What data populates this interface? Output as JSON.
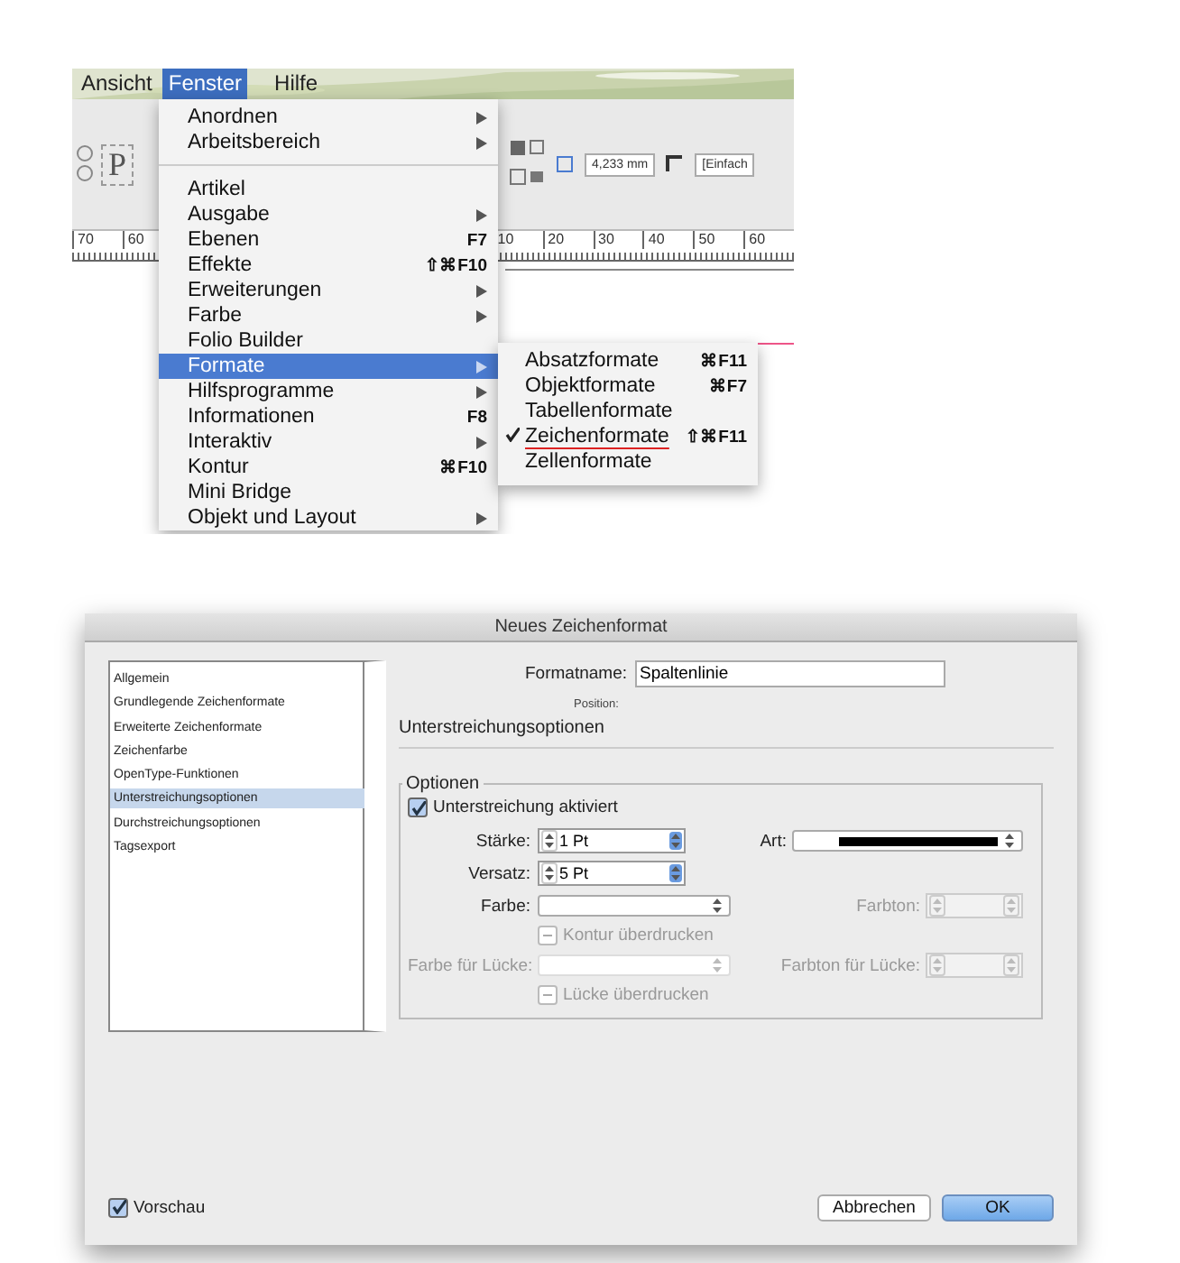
{
  "document_window": {
    "menu_bar": [
      {
        "label": "Ansicht",
        "selected": false
      },
      {
        "label": "Fenster",
        "selected": true
      },
      {
        "label": "Hilfe",
        "selected": false
      }
    ],
    "toolbar": {
      "style_letter": "P",
      "offset_field": "4,233 mm",
      "style_field": "[Einfach"
    },
    "ruler": {
      "left_labels": [
        "70",
        "60"
      ],
      "right_labels": [
        "10",
        "20",
        "30",
        "40",
        "50",
        "60"
      ]
    },
    "menu": [
      {
        "kind": "item",
        "label": "Anordnen",
        "has_submenu": true,
        "selected": false
      },
      {
        "kind": "item",
        "label": "Arbeitsbereich",
        "has_submenu": true,
        "selected": false
      },
      {
        "kind": "separator"
      },
      {
        "kind": "item",
        "label": "Artikel",
        "has_submenu": false,
        "selected": false
      },
      {
        "kind": "item",
        "label": "Ausgabe",
        "has_submenu": true,
        "selected": false
      },
      {
        "kind": "item",
        "label": "Ebenen",
        "shortcut": "F7",
        "has_submenu": false,
        "selected": false
      },
      {
        "kind": "item",
        "label": "Effekte",
        "shortcut": "⇧⌘F10",
        "has_submenu": false,
        "selected": false
      },
      {
        "kind": "item",
        "label": "Erweiterungen",
        "has_submenu": true,
        "selected": false
      },
      {
        "kind": "item",
        "label": "Farbe",
        "has_submenu": true,
        "selected": false
      },
      {
        "kind": "item",
        "label": "Folio Builder",
        "has_submenu": false,
        "selected": false
      },
      {
        "kind": "item",
        "label": "Formate",
        "has_submenu": true,
        "selected": true
      },
      {
        "kind": "item",
        "label": "Hilfsprogramme",
        "has_submenu": true,
        "selected": false
      },
      {
        "kind": "item",
        "label": "Informationen",
        "shortcut": "F8",
        "has_submenu": false,
        "selected": false
      },
      {
        "kind": "item",
        "label": "Interaktiv",
        "has_submenu": true,
        "selected": false
      },
      {
        "kind": "item",
        "label": "Kontur",
        "shortcut": "⌘F10",
        "has_submenu": false,
        "selected": false
      },
      {
        "kind": "item",
        "label": "Mini Bridge",
        "has_submenu": false,
        "selected": false
      },
      {
        "kind": "item",
        "label": "Objekt und Layout",
        "has_submenu": true,
        "selected": false
      }
    ],
    "submenu": [
      {
        "label": "Absatzformate",
        "shortcut": "⌘F11",
        "checked": false
      },
      {
        "label": "Objektformate",
        "shortcut": "⌘F7",
        "checked": false
      },
      {
        "label": "Tabellenformate",
        "checked": false
      },
      {
        "label": "Zeichenformate",
        "shortcut": "⇧⌘F11",
        "checked": true
      },
      {
        "label": "Zellenformate",
        "checked": false
      }
    ]
  },
  "dialog": {
    "title": "Neues Zeichenformat",
    "categories": [
      {
        "label": "Allgemein",
        "selected": false
      },
      {
        "label": "Grundlegende Zeichenformate",
        "selected": false
      },
      {
        "label": "Erweiterte Zeichenformate",
        "selected": false
      },
      {
        "label": "Zeichenfarbe",
        "selected": false
      },
      {
        "label": "OpenType-Funktionen",
        "selected": false
      },
      {
        "label": "Unterstreichungsoptionen",
        "selected": true
      },
      {
        "label": "Durchstreichungsoptionen",
        "selected": false
      },
      {
        "label": "Tagsexport",
        "selected": false
      }
    ],
    "format_name": {
      "label": "Formatname:",
      "value": "Spaltenlinie"
    },
    "position_label": "Position:",
    "section_title": "Unterstreichungsoptionen",
    "group": {
      "title": "Optionen",
      "enable": {
        "label": "Unterstreichung aktiviert",
        "checked": true
      },
      "rows": [
        {
          "left": {
            "kind": "spinner",
            "label": "Stärke:",
            "value": "1 Pt",
            "disabled": false
          },
          "right": {
            "kind": "line_select",
            "label": "Art:",
            "disabled": false
          }
        },
        {
          "left": {
            "kind": "spinner",
            "label": "Versatz:",
            "value": "5 Pt",
            "disabled": false
          }
        },
        {
          "left": {
            "kind": "select",
            "label": "Farbe:",
            "disabled": false
          },
          "right": {
            "kind": "spinner",
            "label": "Farbton:",
            "disabled": true
          }
        },
        {
          "left": {
            "kind": "checkbox",
            "label": "Kontur überdrucken",
            "mixed": true,
            "disabled": true
          }
        },
        {
          "left": {
            "kind": "select",
            "label": "Farbe für Lücke:",
            "disabled": true
          },
          "right": {
            "kind": "spinner",
            "label": "Farbton für Lücke:",
            "disabled": true
          }
        },
        {
          "left": {
            "kind": "checkbox",
            "label": "Lücke überdrucken",
            "mixed": true,
            "disabled": true
          }
        }
      ]
    },
    "preview": {
      "label": "Vorschau",
      "checked": true
    },
    "buttons": [
      {
        "label": "Abbrechen",
        "default": false
      },
      {
        "label": "OK",
        "default": true
      }
    ]
  }
}
